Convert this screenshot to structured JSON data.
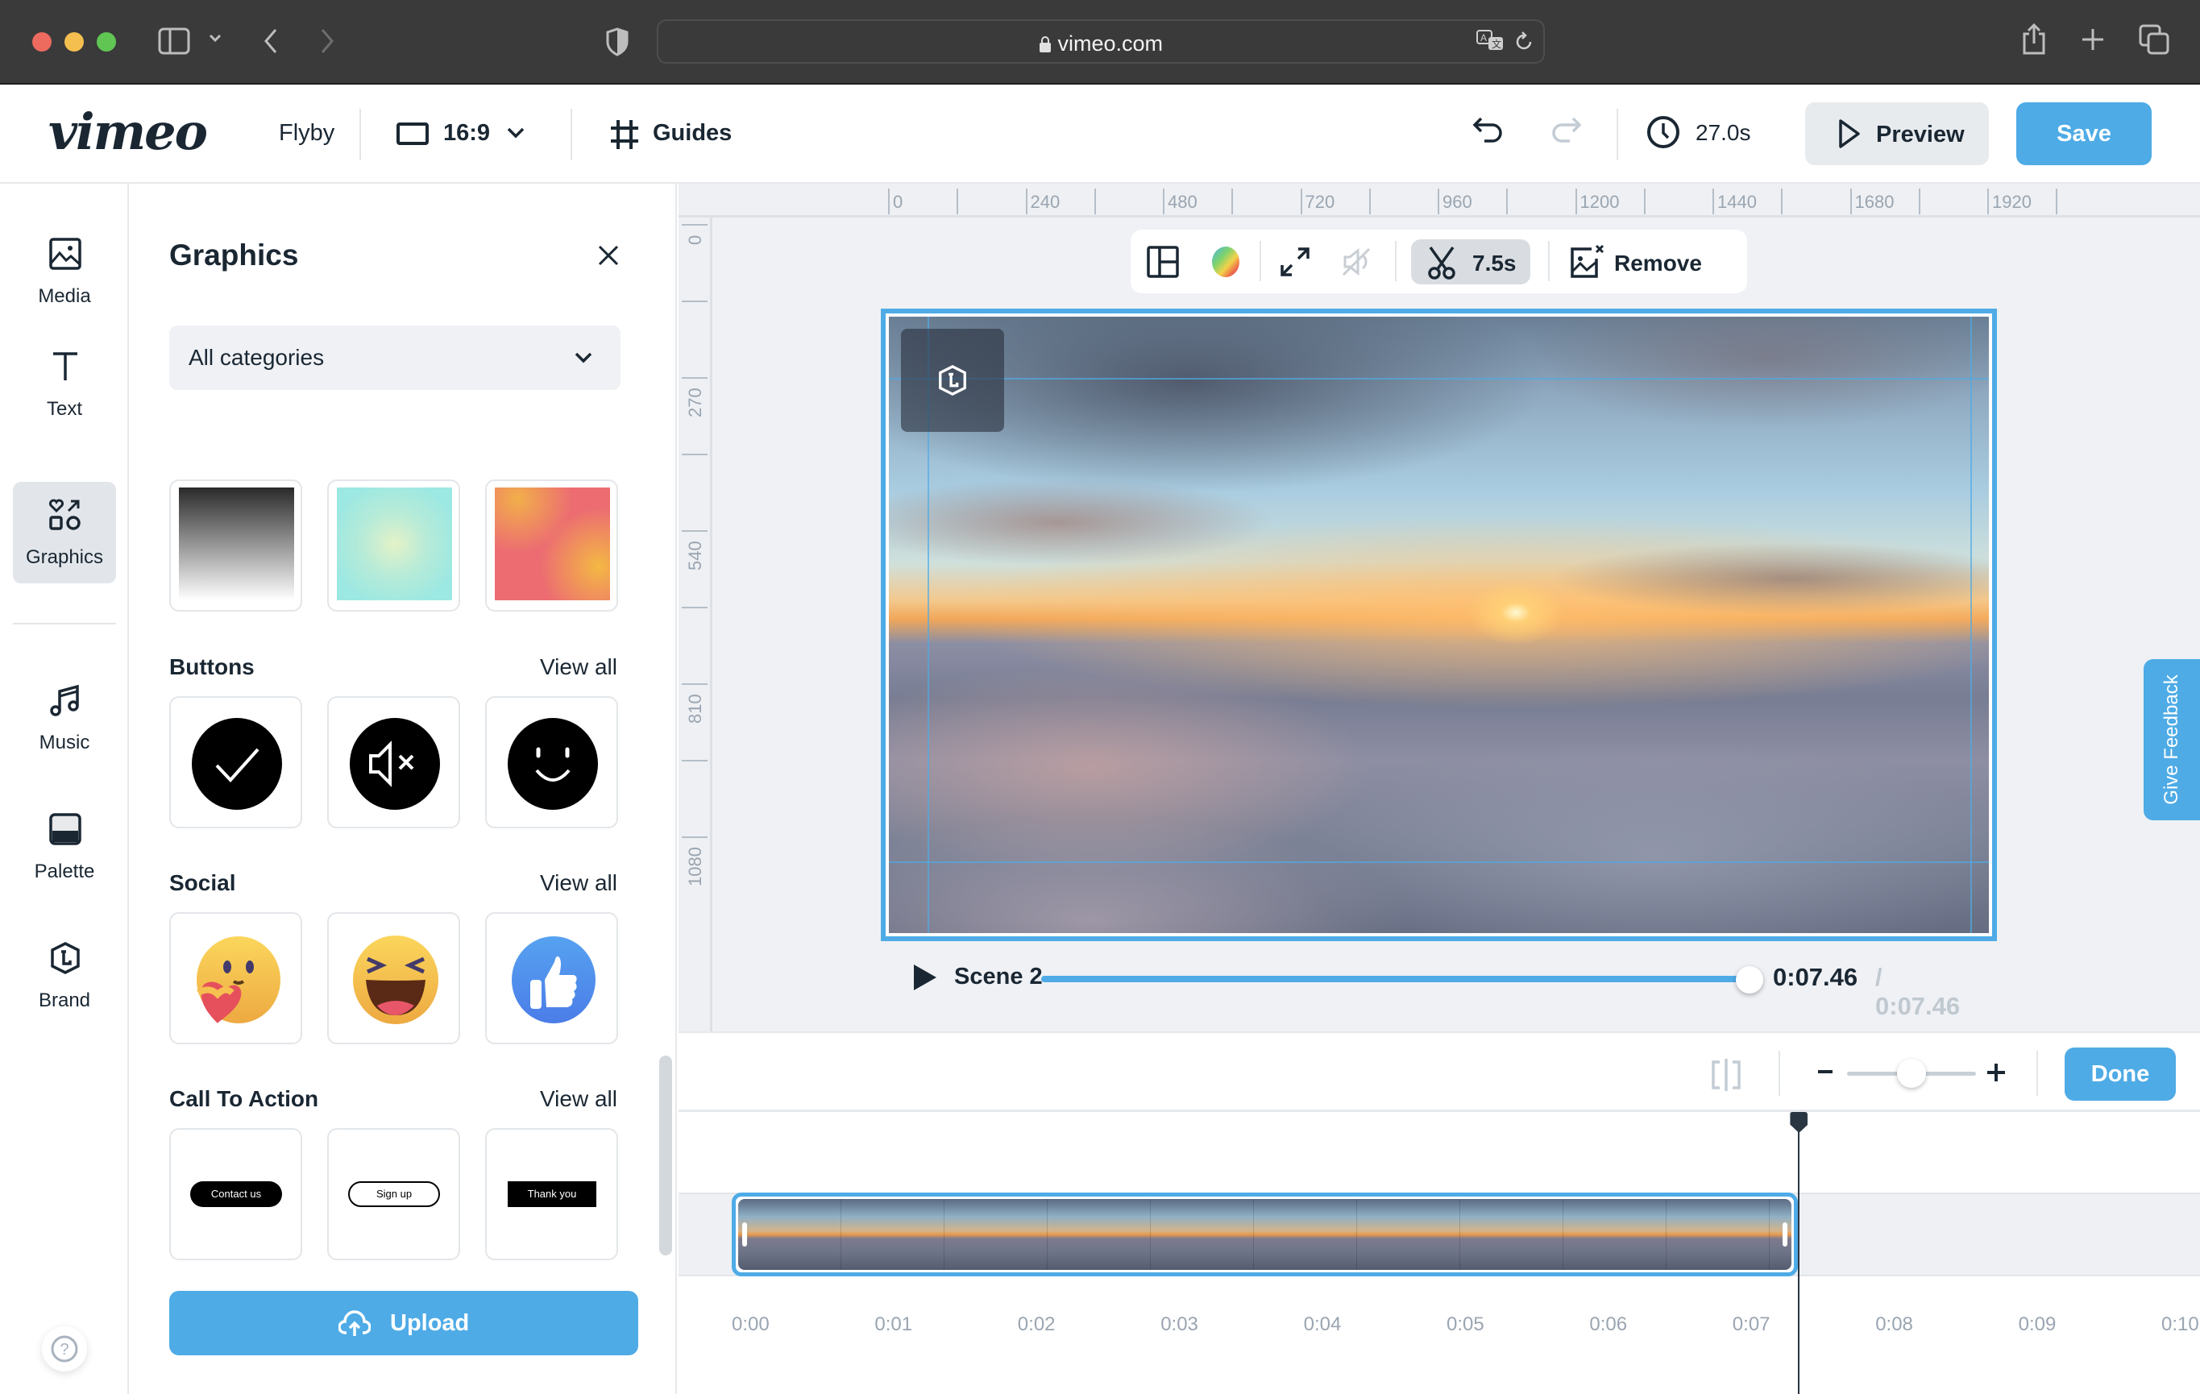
{
  "browser": {
    "url": "vimeo.com",
    "traffic_lights": {
      "close": "#ec6a5e",
      "minimize": "#f4bf4f",
      "maximize": "#61c554"
    }
  },
  "header": {
    "logo": "vimeo",
    "project_name": "Flyby",
    "aspect_ratio": "16:9",
    "guides_label": "Guides",
    "duration": "27.0s",
    "preview_label": "Preview",
    "save_label": "Save"
  },
  "rail": {
    "items": [
      {
        "label": "Media",
        "icon": "image-icon"
      },
      {
        "label": "Text",
        "icon": "text-icon"
      },
      {
        "label": "Graphics",
        "icon": "graphics-icon",
        "active": true
      },
      {
        "label": "Music",
        "icon": "music-icon"
      },
      {
        "label": "Palette",
        "icon": "palette-icon"
      },
      {
        "label": "Brand",
        "icon": "brand-icon"
      }
    ],
    "help_label": "?"
  },
  "panel": {
    "title": "Graphics",
    "category_select": "All categories",
    "backgrounds": [
      {
        "name": "gray-gradient"
      },
      {
        "name": "mint-gradient"
      },
      {
        "name": "sunset-gradient"
      }
    ],
    "sections": [
      {
        "title": "Buttons",
        "view_all": "View all",
        "items": [
          "check-button",
          "mute-button",
          "smile-button"
        ]
      },
      {
        "title": "Social",
        "view_all": "View all",
        "items": [
          "care-emoji",
          "laugh-emoji",
          "thumbs-up"
        ]
      },
      {
        "title": "Call To Action",
        "view_all": "View all",
        "items": [
          "Contact us",
          "Sign up",
          "Thank you"
        ]
      }
    ],
    "upload_label": "Upload"
  },
  "canvas": {
    "hruler": [
      "0",
      "240",
      "480",
      "720",
      "960",
      "1200",
      "1440",
      "1680",
      "1920"
    ],
    "vruler": [
      "0",
      "270",
      "540",
      "810",
      "1080"
    ],
    "toolbar": {
      "trim_duration": "7.5s",
      "remove_label": "Remove"
    },
    "scene": {
      "title": "Scene 2",
      "current_time": "0:07.46",
      "total_time": "/ 0:07.46",
      "progress": 1.0
    },
    "feedback_label": "Give Feedback"
  },
  "timeline": {
    "done_label": "Done",
    "zoom_level": 0.5,
    "time_labels": [
      "0:00",
      "0:01",
      "0:02",
      "0:03",
      "0:04",
      "0:05",
      "0:06",
      "0:07",
      "0:08",
      "0:09",
      "0:10"
    ],
    "clip_duration_seconds": 7.46,
    "playhead_seconds": 7.46
  },
  "colors": {
    "accent": "#4eabe6",
    "text": "#1a2733",
    "muted": "#9aa5b1"
  }
}
